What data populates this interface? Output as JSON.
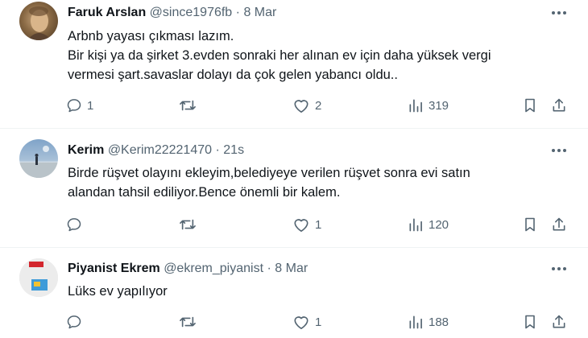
{
  "tweets": [
    {
      "name": "Faruk Arslan",
      "handle": "@since1976fb",
      "separator": "·",
      "time": "8 Mar",
      "lines": [
        "Arbnb yayası çıkması lazım.",
        "Bir kişi ya da şirket 3.evden sonraki her alınan ev için daha yüksek vergi",
        "vermesi şart.savaslar dolayı da çok gelen yabancı oldu.."
      ],
      "replies": "1",
      "retweets": "",
      "likes": "2",
      "views": "319"
    },
    {
      "name": "Kerim",
      "handle": "@Kerim22221470",
      "separator": "·",
      "time": "21s",
      "lines": [
        "Birde rüşvet olayını ekleyim,belediyeye verilen rüşvet sonra evi satın",
        "alandan tahsil ediliyor.Bence önemli bir kalem."
      ],
      "replies": "",
      "retweets": "",
      "likes": "1",
      "views": "120"
    },
    {
      "name": "Piyanist Ekrem",
      "handle": "@ekrem_piyanist",
      "separator": "·",
      "time": "8 Mar",
      "lines": [
        "Lüks ev yapılıyor"
      ],
      "replies": "",
      "retweets": "",
      "likes": "1",
      "views": "188"
    }
  ],
  "icons": {
    "reply": "reply-icon",
    "retweet": "retweet-icon",
    "like": "heart-icon",
    "views": "views-icon",
    "bookmark": "bookmark-icon",
    "share": "share-icon",
    "more": "more-icon"
  },
  "colors": {
    "text": "#0f1419",
    "secondary": "#536471",
    "divider": "#eff3f4"
  }
}
